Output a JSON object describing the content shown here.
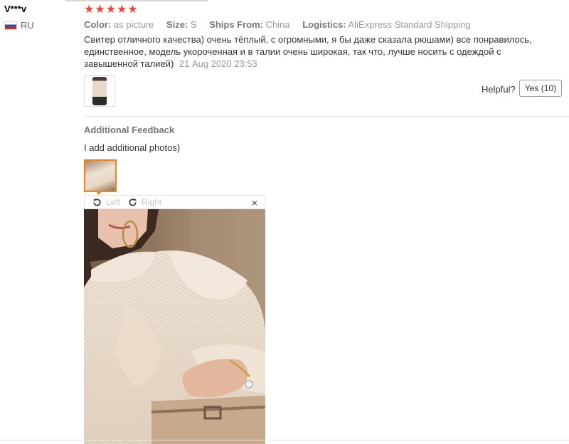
{
  "buyer": {
    "name": "V***v",
    "country": "RU"
  },
  "review": {
    "stars": [
      "★",
      "★",
      "★",
      "★",
      "★"
    ],
    "color_label": "Color:",
    "color_value": "as picture",
    "size_label": "Size:",
    "size_value": "S",
    "ships_label": "Ships From:",
    "ships_value": "China",
    "logistics_label": "Logistics:",
    "logistics_value": "AliExpress Standard Shipping",
    "text": "Свитер отличного качества) очень тёплый, с огромными, я бы даже сказала рюшами) все понравилось, единственное, модель укороченная и в талии очень широкая, так что, лучше носить с одеждой с завышенной талией)",
    "date": "21 Aug 2020 23:53",
    "helpful_label": "Helpful?",
    "yes_label": "Yes (10)"
  },
  "additional": {
    "title": "Additional Feedback",
    "text": "I add additional photos)"
  },
  "viewer": {
    "rotate_left": "Left",
    "rotate_right": "Right",
    "close": "×"
  },
  "colors": {
    "star": "#f44336",
    "active_thumb_border": "#f08220",
    "muted_text": "#999999"
  },
  "icons": [
    "russia-flag-icon",
    "star-icon",
    "rotate-left-icon",
    "rotate-right-icon",
    "close-icon"
  ]
}
